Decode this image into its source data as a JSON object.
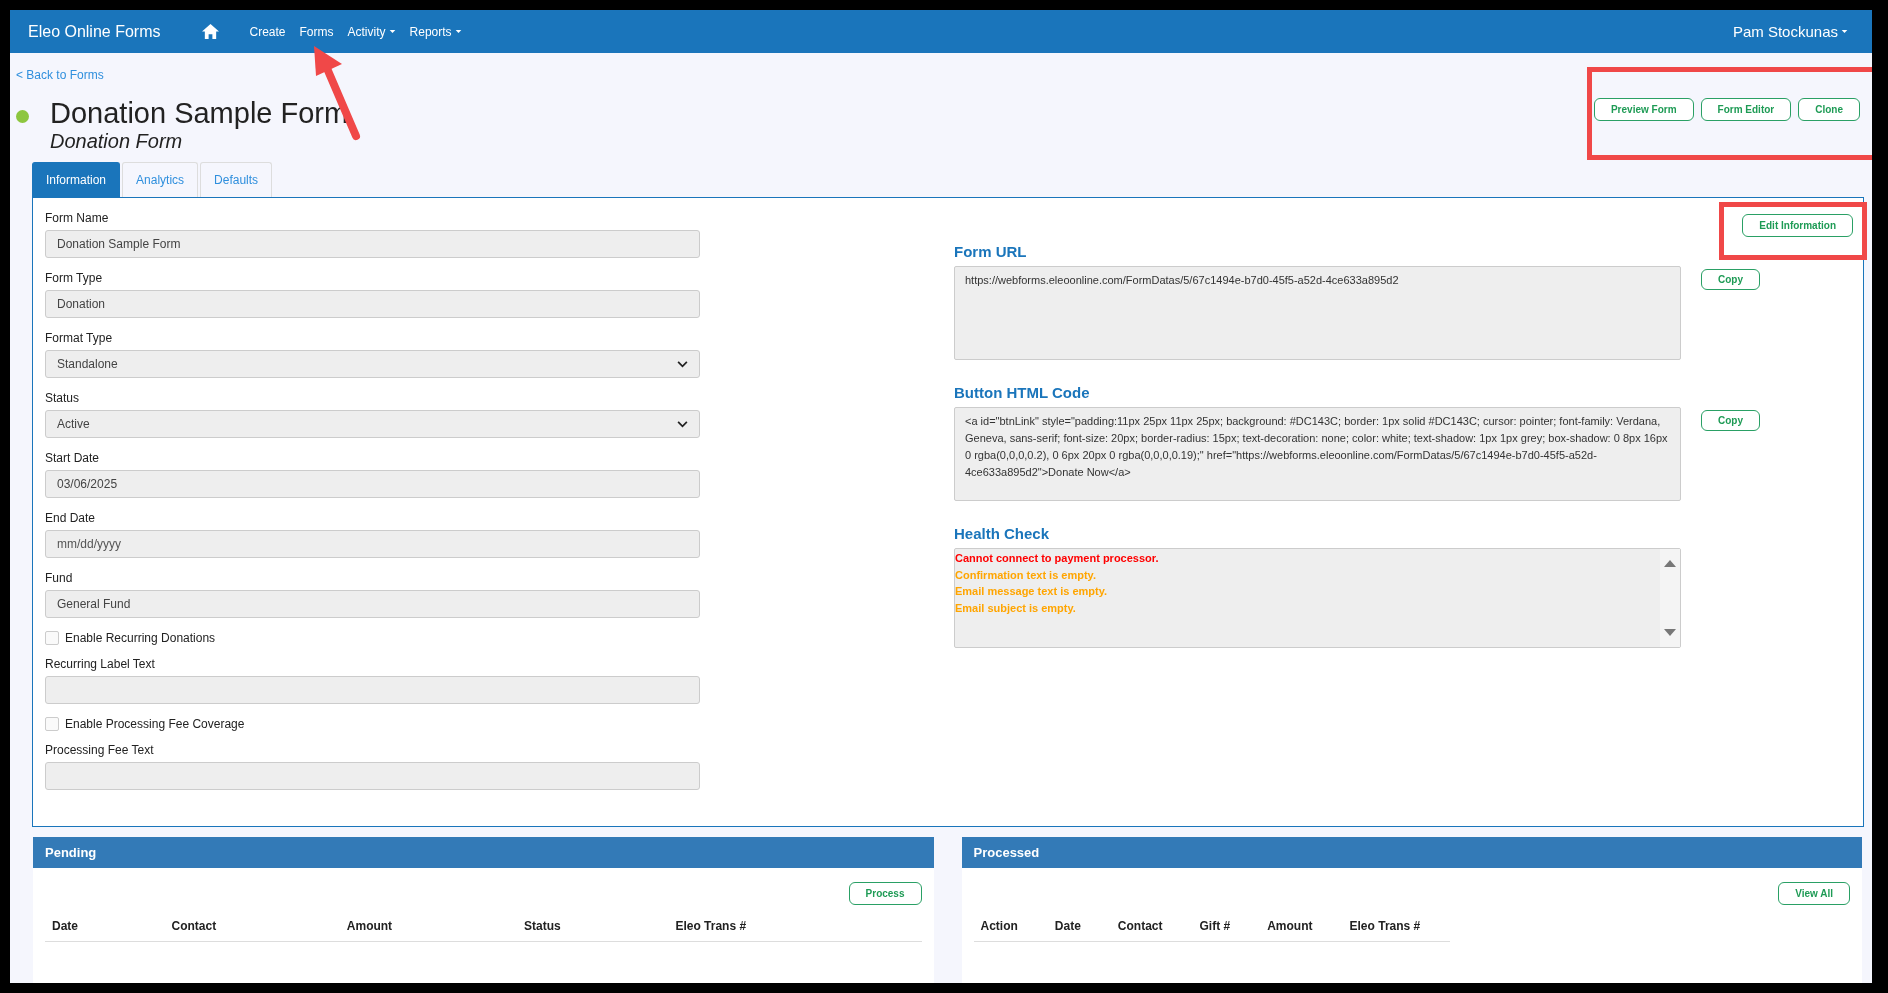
{
  "navbar": {
    "brand": "Eleo Online Forms",
    "items": [
      {
        "label": "Create",
        "dropdown": false
      },
      {
        "label": "Forms",
        "dropdown": false
      },
      {
        "label": "Activity",
        "dropdown": true
      },
      {
        "label": "Reports",
        "dropdown": true
      }
    ],
    "user": "Pam Stockunas"
  },
  "back_link": "< Back to Forms",
  "header": {
    "title": "Donation Sample Form",
    "subtitle": "Donation Form",
    "actions": [
      "Preview Form",
      "Form Editor",
      "Clone"
    ]
  },
  "tabs": [
    {
      "label": "Information",
      "selected": true
    },
    {
      "label": "Analytics",
      "selected": false
    },
    {
      "label": "Defaults",
      "selected": false
    }
  ],
  "form": {
    "fields": [
      {
        "kind": "text",
        "label": "Form Name",
        "value": "Donation Sample Form"
      },
      {
        "kind": "text",
        "label": "Form Type",
        "value": "Donation"
      },
      {
        "kind": "select",
        "label": "Format Type",
        "value": "Standalone"
      },
      {
        "kind": "select",
        "label": "Status",
        "value": "Active"
      },
      {
        "kind": "text",
        "label": "Start Date",
        "value": "03/06/2025"
      },
      {
        "kind": "text",
        "label": "End Date",
        "placeholder": "mm/dd/yyyy"
      },
      {
        "kind": "text",
        "label": "Fund",
        "value": "General Fund"
      },
      {
        "kind": "checkbox",
        "label": "Enable Recurring Donations",
        "checked": false
      },
      {
        "kind": "text",
        "label": "Recurring Label Text"
      },
      {
        "kind": "checkbox",
        "label": "Enable Processing Fee Coverage",
        "checked": false
      },
      {
        "kind": "text",
        "label": "Processing Fee Text"
      }
    ]
  },
  "info": {
    "edit_button": "Edit Information",
    "form_url": {
      "title": "Form URL",
      "value": "https://webforms.eleoonline.com/FormDatas/5/67c1494e-b7d0-45f5-a52d-4ce633a895d2",
      "copy": "Copy"
    },
    "button_html": {
      "title": "Button HTML Code",
      "value": "<a id=\"btnLink\" style=\"padding:11px 25px 11px 25px; background: #DC143C; border: 1px solid #DC143C; cursor: pointer; font-family: Verdana, Geneva, sans-serif; font-size: 20px; border-radius: 15px;  text-decoration: none;  color: white; text-shadow: 1px 1px grey; box-shadow: 0 8px 16px 0 rgba(0,0,0,0.2), 0 6px 20px 0 rgba(0,0,0,0.19);\" href=\"https://webforms.eleoonline.com/FormDatas/5/67c1494e-b7d0-45f5-a52d-4ce633a895d2\">Donate Now</a>",
      "copy": "Copy"
    },
    "health_check": {
      "title": "Health Check",
      "messages": [
        {
          "text": "Cannot connect to payment processor.",
          "color": "#ff0000"
        },
        {
          "text": "Confirmation text is empty.",
          "color": "#ffa500"
        },
        {
          "text": "Email message text is empty.",
          "color": "#ffa500"
        },
        {
          "text": "Email subject is empty.",
          "color": "#ffa500"
        }
      ]
    }
  },
  "pending": {
    "title": "Pending",
    "button": "Process",
    "columns": [
      "Date",
      "Contact",
      "Amount",
      "Status",
      "Eleo Trans #"
    ]
  },
  "processed": {
    "title": "Processed",
    "button": "View All",
    "columns": [
      "Action",
      "Date",
      "Contact",
      "Gift #",
      "Amount",
      "Eleo Trans #"
    ]
  }
}
